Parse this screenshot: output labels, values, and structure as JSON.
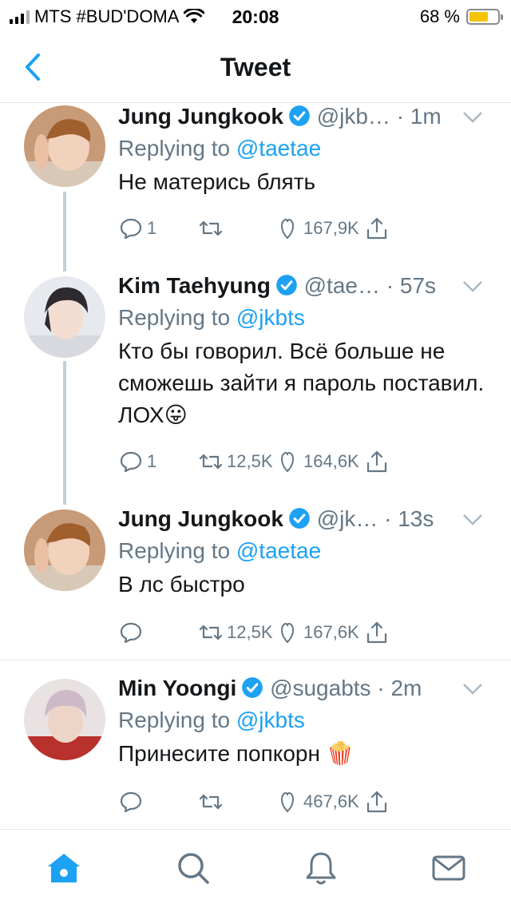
{
  "status_bar": {
    "carrier": "MTS #BUD'DOMA",
    "time": "20:08",
    "battery": "68 %",
    "battery_level": 0.68
  },
  "header": {
    "title": "Tweet"
  },
  "tweets": [
    {
      "name": "Jung Jungkook",
      "handle": "@jkb…",
      "time": "· 1m",
      "replying_prefix": "Replying to ",
      "replying_to": "@taetae",
      "text": "Не матерись блять",
      "replies": "1",
      "retweets": "",
      "likes": "167,9K"
    },
    {
      "name": "Kim Taehyung",
      "handle": "@tae…",
      "time": "· 57s",
      "replying_prefix": "Replying to ",
      "replying_to": "@jkbts",
      "text": "Кто бы говорил. Всё больше не сможешь зайти я пароль поставил. ЛОХ😛",
      "replies": "1",
      "retweets": "12,5K",
      "likes": "164,6K"
    },
    {
      "name": "Jung Jungkook",
      "handle": "@jk…",
      "time": "· 13s",
      "replying_prefix": "Replying to ",
      "replying_to": "@taetae",
      "text": "В лс быстро",
      "replies": "",
      "retweets": "12,5K",
      "likes": "167,6K"
    },
    {
      "name": "Min Yoongi",
      "handle": "@sugabts",
      "time": "· 2m",
      "replying_prefix": "Replying to ",
      "replying_to": "@jkbts",
      "text": "Принесите попкорн 🍿",
      "replies": "",
      "retweets": "",
      "likes": "467,6K"
    }
  ],
  "tabbar": {
    "active": "home",
    "tabs": [
      "home-icon",
      "search-icon",
      "notifications-icon",
      "messages-icon"
    ]
  },
  "colors": {
    "accent": "#1da1f2",
    "secondary_text": "#657786",
    "divider": "#e1e8ed"
  }
}
